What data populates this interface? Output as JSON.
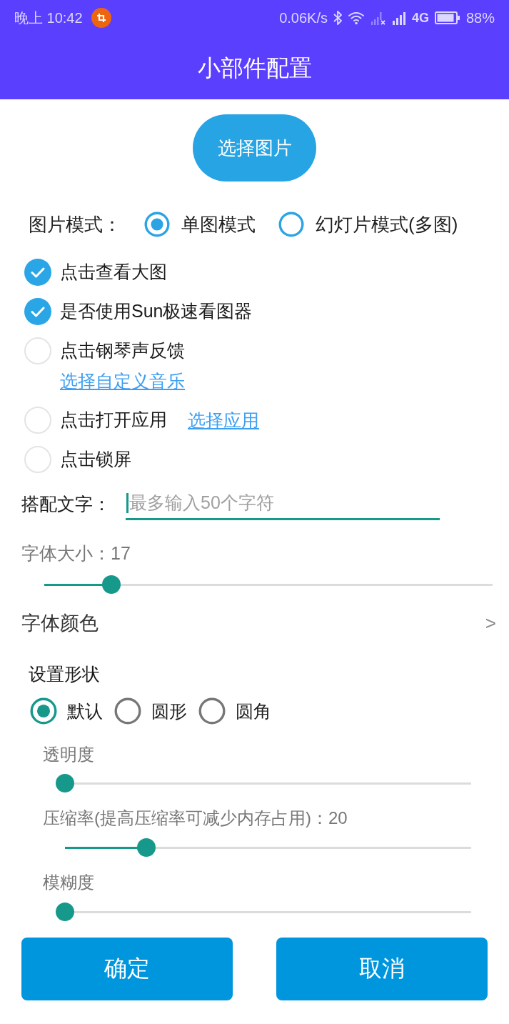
{
  "status_bar": {
    "time": "晚上 10:42",
    "net_speed": "0.06K/s",
    "network_type": "4G",
    "battery": "88%"
  },
  "app_bar": {
    "title": "小部件配置"
  },
  "pick_image_button": {
    "label": "选择图片"
  },
  "image_mode": {
    "label": "图片模式：",
    "options": [
      {
        "label": "单图模式",
        "selected": true
      },
      {
        "label": "幻灯片模式(多图)",
        "selected": false
      }
    ]
  },
  "options": [
    {
      "label": "点击查看大图",
      "checked": true
    },
    {
      "label": "是否使用Sun极速看图器",
      "checked": true
    },
    {
      "label": "点击钢琴声反馈",
      "checked": false,
      "link_below": "选择自定义音乐"
    },
    {
      "label": "点击打开应用",
      "checked": false,
      "link_inline": "选择应用"
    },
    {
      "label": "点击锁屏",
      "checked": false
    }
  ],
  "caption": {
    "label": "搭配文字：",
    "placeholder": "最多输入50个字符",
    "focused": true
  },
  "font_size": {
    "label": "字体大小：17",
    "level": 0.15
  },
  "font_color": {
    "label": "字体颜色",
    "chevron": ">"
  },
  "shape": {
    "title": "设置形状",
    "options": [
      {
        "label": "默认",
        "selected": true
      },
      {
        "label": "圆形",
        "selected": false
      },
      {
        "label": "圆角",
        "selected": false
      }
    ]
  },
  "sliders": [
    {
      "label": "透明度",
      "level": 0
    },
    {
      "label": "压缩率(提高压缩率可减少内存占用)：20",
      "level": 0.2
    },
    {
      "label": "模糊度",
      "level": 0
    }
  ],
  "buttons": [
    {
      "label": "确定"
    },
    {
      "label": "取消"
    }
  ]
}
